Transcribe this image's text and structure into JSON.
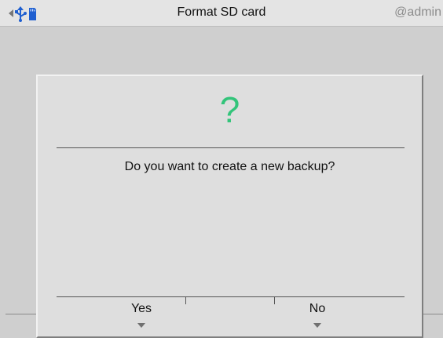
{
  "header": {
    "title": "Format SD card",
    "user": "@admin",
    "icons": [
      "scroll-left-arrow-icon",
      "usb-icon",
      "sd-card-icon"
    ],
    "icon_color": "#1f5fd0"
  },
  "dialog": {
    "icon": "question-mark",
    "icon_glyph": "?",
    "icon_color": "#33c47a",
    "message": "Do you want to create a new backup?",
    "buttons": {
      "yes": "Yes",
      "no": "No"
    }
  }
}
